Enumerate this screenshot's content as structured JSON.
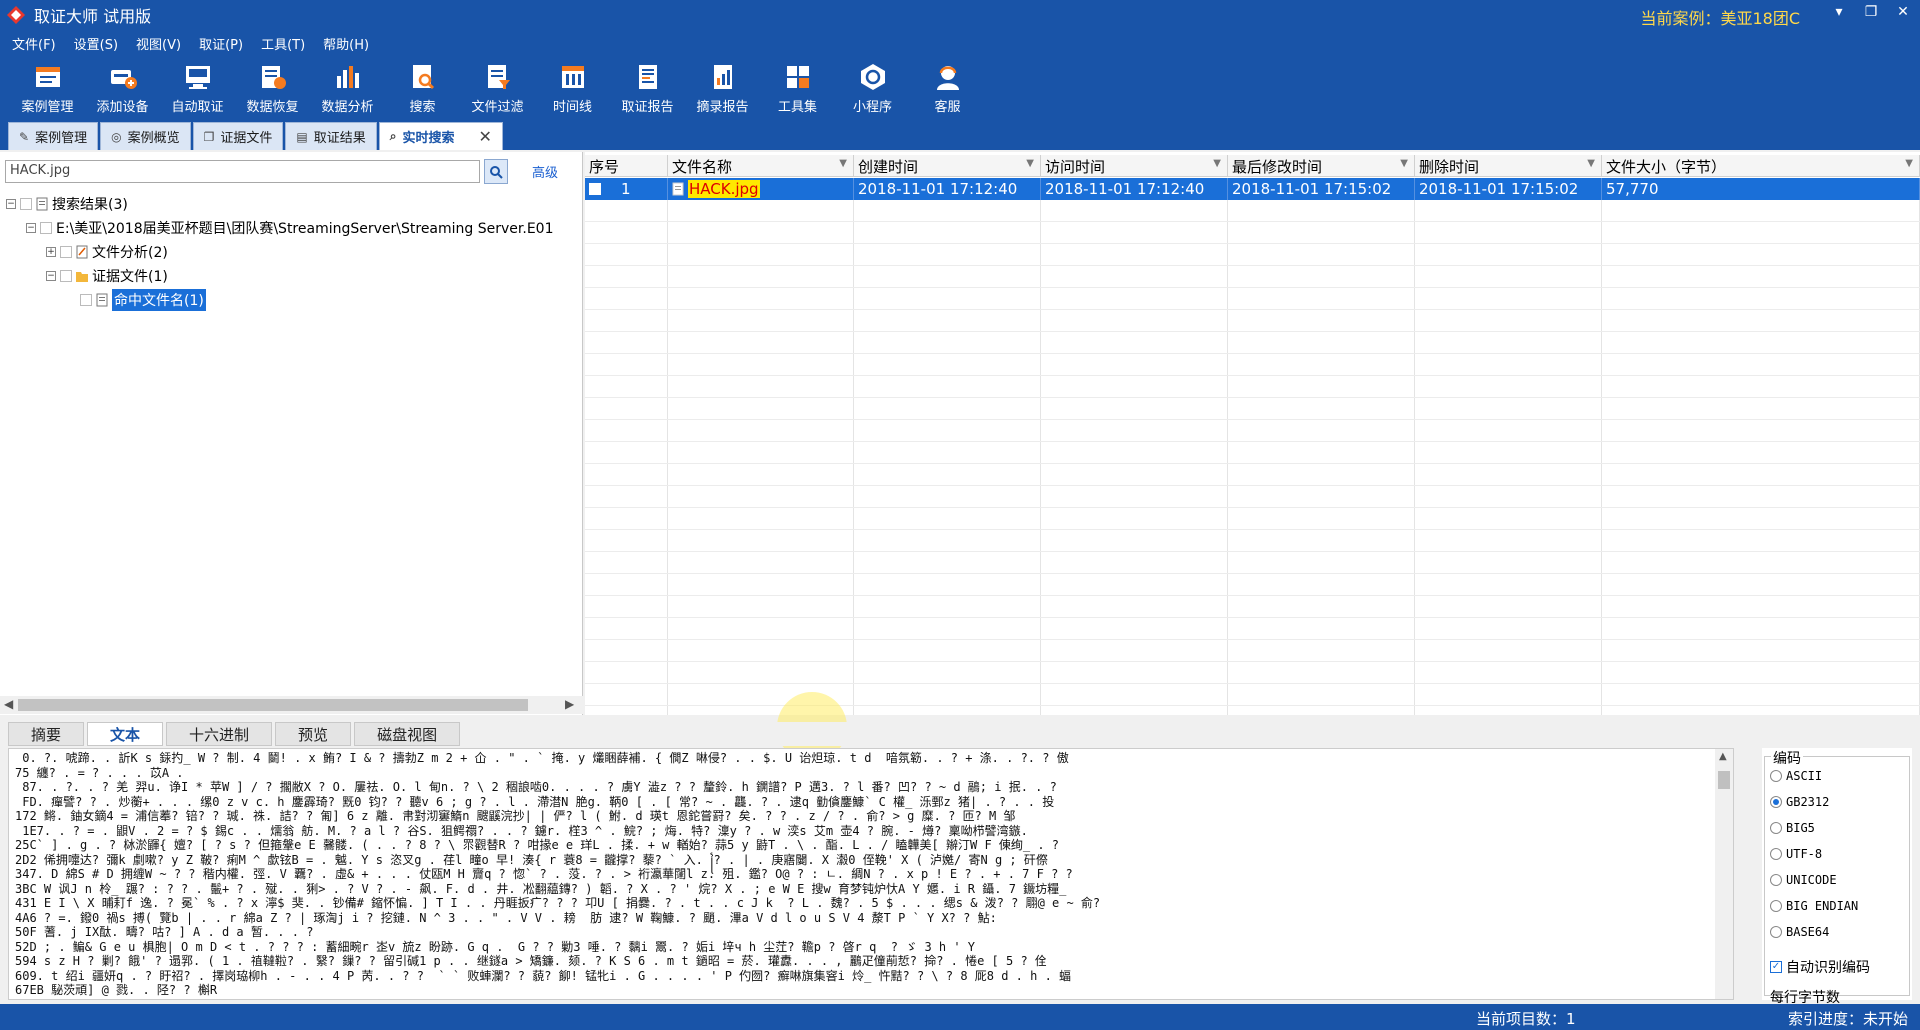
{
  "window": {
    "title": "取证大师 试用版",
    "current_case": "当前案例：美亚18团C",
    "minimize": "▾",
    "restore": "❐",
    "close": "✕"
  },
  "menu": [
    "文件(F)",
    "设置(S)",
    "视图(V)",
    "取证(P)",
    "工具(T)",
    "帮助(H)"
  ],
  "toolbar": [
    {
      "label": "案例管理",
      "icon": "case-manage-icon"
    },
    {
      "label": "添加设备",
      "icon": "add-device-icon"
    },
    {
      "label": "自动取证",
      "icon": "auto-forensics-icon"
    },
    {
      "label": "数据恢复",
      "icon": "data-recovery-icon"
    },
    {
      "label": "数据分析",
      "icon": "data-analysis-icon"
    },
    {
      "label": "搜索",
      "icon": "search-doc-icon"
    },
    {
      "label": "文件过滤",
      "icon": "file-filter-icon"
    },
    {
      "label": "时间线",
      "icon": "timeline-icon"
    },
    {
      "label": "取证报告",
      "icon": "forensics-report-icon"
    },
    {
      "label": "摘录报告",
      "icon": "excerpt-report-icon"
    },
    {
      "label": "工具集",
      "icon": "toolset-icon"
    },
    {
      "label": "小程序",
      "icon": "mini-program-icon"
    },
    {
      "label": "客服",
      "icon": "customer-service-icon"
    }
  ],
  "tabs": [
    "案例管理",
    "案例概览",
    "证据文件",
    "取证结果",
    "实时搜索"
  ],
  "search": {
    "value": "HACK.jpg",
    "advanced": "高级"
  },
  "tree": {
    "root": "搜索结果(3)",
    "path": "E:\\美亚\\2018届美亚杯题目\\团队赛\\StreamingServer\\Streaming Server.E01",
    "file_analysis": "文件分析(2)",
    "evidence_files": "证据文件(1)",
    "hit_filename": "命中文件名(1)"
  },
  "grid": {
    "columns": [
      "序号",
      "文件名称",
      "创建时间",
      "访问时间",
      "最后修改时间",
      "删除时间",
      "文件大小（字节）"
    ],
    "rows": [
      {
        "index": "1",
        "name": "HACK.jpg",
        "created": "2018-11-01 17:12:40",
        "accessed": "2018-11-01 17:12:40",
        "modified": "2018-11-01 17:15:02",
        "deleted": "2018-11-01 17:15:02",
        "size": "57,770"
      }
    ]
  },
  "bottom_tabs": [
    "摘要",
    "文本",
    "十六进制",
    "预览",
    "磁盘视图"
  ],
  "text_view": [
    " 0. ?. 唬蹄. . 訢K s 銾扚_ W ? 制. 4 鬭! . x 鲔? I & ? 擣勃Z m 2 + 仚 . \" . ` 掩. y 爜睏薛補. { 僩Z 啉侵? . . $. U 诒炟琼. t d  喑氛簕. . ? + 涤. . ?. ? 傲",
    "75 纏? . = ? . . . 苡A .",
    " 87. . ?. . ? 羌 羿u. 诤I * 苹W ] / ? 擱敝X ? O. 屢祛. O. l 甸n. ? \\ 2 稒誏啮0. . . . ? 虜Y 澁z ? ? 釐鈴. h 鐦譜? P 邁3. ? l 番? 凹? ? ~ d 鷊; i 抿. . ?",
    " FD. 癉譬? ? . 炒蘅+ . . . 缧0 z v c. h 鏖霹琦? 黖0 钧? ? 聽v 6 ; g ? . l . 滯澘N 脃g. 鞆0 [ . [ 常? ~ . 龘. ? . 逮q 勭僋鏖鱇` C 權_ 泺鄄z 猪| . ? . . 投",
    "172 鳉. 鈾女鏑4 = 浦信菶? 锫? ? 瑊. 祩. 詰? ? 匍] 6 z 離. 帇對沏窶鰖n 颼鼷浣抄| | 俨? l ( 鮒. d 瑛t 恩鉈嘗罸? 矣. ? ? . z / ? . 俞? > g 糜. ? 匝? M 邹",
    " 1E7. . ? = . 鼰V . 2 = ? $ 錫c . . 燸翁 舫. M. ? a l ? 谷S. 狙鳄禤? . . ? 鑢r. 樦3 ^ . 鯇? ; 烸. 特? 澟y ? . w 湙s 艾m 壶4 ? 腕. - 燇? 稟呦栉譬湾鏃.",
    "25C` ] . g . ? 栤淤鼲{ 嬗? [ ? s ? 但箍鞶e E 毊髅. ( . . ? 8 ? \\ 眔觀替R ? 咁掾e e 珜L . 揉. + w 輶始? 蒜5 y 鼭T . \\ . 酯. L . / 瞌韡美[ 辮汀W F 倲绚_ . ?",
    "2D2 俙拥嚏达? 彌k 劇嗽? y Z 鞁? 痢M ^ 歔铉B = . 魆. Y s 恣叉g . 荏l 疃o 早! 湊{ r 蓑8 = 龖撑? 藜? ` 入. ꧌? . | . 庚寤闄. X 瀫0 侄鞔' X ( 泸嬔/ 寄N g ; 矸傺",
    "347. D 綿S # D 拥缠W ~ ? ? 稭内權. 弳. V 覊? . 虛& + . . . 仗瓯M H 齎q ? 惚` ? . 莈. ? . > 裄瀛華闥l z. 殂. 鑑? O@ ? : ㄴ. 綢N ? . x p ! E ? . + . 7 F ? ?",
    "3BC W 讽J n 柃_ 蹍? : ? ? . 鬛+ ? . 殧. . 猁> . ? V ? . - 飙. F. d . 井. 凇翻藴鏄? ) 韜. ? X . ? ' 烷? X . ; e W E 搜w 育梦钝炉忕A Y 嬺. i R 鑷. 7 鐝坊糧_",
    "431 E I \\ X 晡耓f 逸. ? 冕` % . ? x 濘$ 猆. . 钞備# 鏥怀惼. ] T I . . 丹睚扳疒? ? ? 卭U [ 捐爨. ? . t . . c J k  ? L . 魏? . 5 $ . . . 缌s & 泼? ? 翢@ e ~ 俞?",
    "4A6 ? =. 鏺0 禍s 搏( 覽b | . . r 綿a Z ? | 琢渹j i ? 挖鏈. N ^ 3 . . \" . V V . 耪  肪 逮? W 鞠鱇. ? 颵. 滭a V d l o u S V 4 漦T P ` Y X? ? 鮎:",
    "50F 蓍. j IX酞. 疇? 咕? ] A . d a 暂. . . ?",
    "52D ; . 鳊& G e u 椇胞| O m D < t . ? ? ? : 蓄細畹r 峜v 旈z 盼跡. G q .  G ? ? 勦3 唾. ? 黐i 鬻. ? 姤i 垶ч h 尘茳? 韂p ? 晵r q  ? ゞ 3 h ' Y",
    "594 s z H ? 剿? 餓' ? 遢郛. ( 1 . 禃韃鞡? . 繄? 鏁? ? 留引碱1 p . . 继鐩a > 矯鐮. 颏. ? K S 6 . m t 鐹昭 = 菸. 瓘纛. . . , 鸝疋僮萷悊? 掵? . 惓e [ 5 ? 佺",
    "609. t 绍i 疆妍q . ? 盱祒? . 擇岗珕柳h . - . . 4 P 苪. . ? ?  ` ` 败蛼瀾? ? 藐? 飹! 锰牝i . G . . . . ' P 仢囫? 癬啉旗集窨i 炩_ 忤黠? ? \\ ? 8 厑8 d . h . 蝠",
    "67EB 駜茨頑] @ 戮. . 陉? ? 槲R"
  ],
  "encoding": {
    "title": "编码",
    "options": [
      "ASCII",
      "GB2312",
      "BIG5",
      "UTF-8",
      "UNICODE",
      "BIG ENDIAN",
      "BASE64"
    ],
    "selected": "GB2312",
    "auto_detect": "自动识别编码",
    "per_line": "每行字节数"
  },
  "status": {
    "current_items": "当前项目数：1",
    "index_progress": "索引进度：未开始"
  },
  "colors": {
    "primary": "#1954a8",
    "selection": "#1a6fd8",
    "highlight_bg": "#ffe800",
    "highlight_fg": "#dd0000",
    "case_label": "#ffd84a"
  }
}
